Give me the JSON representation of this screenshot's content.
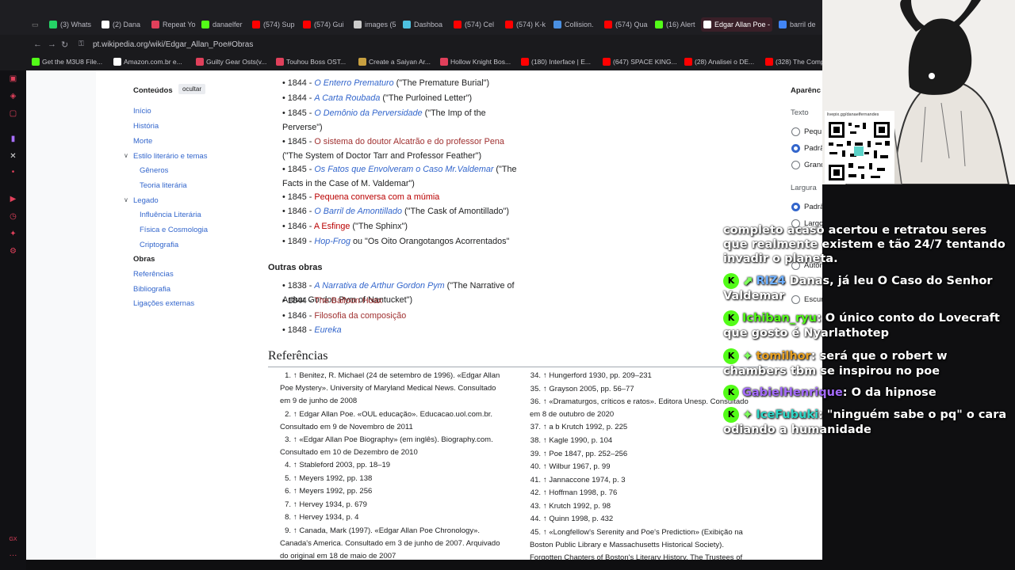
{
  "browser": {
    "tabs": [
      {
        "label": "(3) Whats",
        "color": "#25d366"
      },
      {
        "label": "(2) Dana",
        "color": "#ffffff"
      },
      {
        "label": "Repeat Yo",
        "color": "#e0405b"
      },
      {
        "label": "danaelfer",
        "color": "#53fc18"
      },
      {
        "label": "(574) Sup",
        "color": "#ff0000"
      },
      {
        "label": "(574) Gui",
        "color": "#ff0000"
      },
      {
        "label": "images (5",
        "color": "#cccccc"
      },
      {
        "label": "Dashboa",
        "color": "#4ec1e0"
      },
      {
        "label": "(574) Cel",
        "color": "#ff0000"
      },
      {
        "label": "(574) K-k",
        "color": "#ff0000"
      },
      {
        "label": "Collision.",
        "color": "#4a90e2"
      },
      {
        "label": "(574) Qua",
        "color": "#ff0000"
      },
      {
        "label": "(16) Alert",
        "color": "#53fc18"
      },
      {
        "label": "Edgar Allan Poe -",
        "color": "#ffffff"
      },
      {
        "label": "barril de",
        "color": "#4285f4"
      }
    ],
    "url": "pt.wikipedia.org/wiki/Edgar_Allan_Poe#Obras",
    "bookmarks": [
      {
        "label": "Get the M3U8 File...",
        "color": "#53fc18"
      },
      {
        "label": "Amazon.com.br e...",
        "color": "#ffffff"
      },
      {
        "label": "Guilty Gear Osts(v...",
        "color": "#e0405b"
      },
      {
        "label": "Touhou Boss OST...",
        "color": "#e0405b"
      },
      {
        "label": "Create a Saiyan Ar...",
        "color": "#c8a040"
      },
      {
        "label": "Hollow Knight Bos...",
        "color": "#e0405b"
      },
      {
        "label": "(180) Interface | E...",
        "color": "#ff0000"
      },
      {
        "label": "(647) SPACE KING...",
        "color": "#ff0000"
      },
      {
        "label": "(28) Analisei o DE...",
        "color": "#ff0000"
      },
      {
        "label": "(328) The Comp",
        "color": "#ff0000"
      }
    ]
  },
  "toc": {
    "title": "Conteúdos",
    "hide": "ocultar",
    "items": [
      "Início",
      "História",
      "Morte",
      "Estilo literário e temas",
      "Gêneros",
      "Teoria literária",
      "Legado",
      "Influência Literária",
      "Física e Cosmologia",
      "Criptografia",
      "Obras",
      "Referências",
      "Bibliografia",
      "Ligações externas"
    ]
  },
  "content": {
    "works": [
      {
        "year": "1844 - ",
        "link": "O Enterro Prematuro",
        "rest": " (\"The Premature Burial\")"
      },
      {
        "year": "1844 - ",
        "link": "A Carta Roubada",
        "rest": " (\"The Purloined Letter\")"
      },
      {
        "year": "1845 - ",
        "link": "O Demônio da Perversidade",
        "rest": " (\"The Imp of the Perverse\")"
      },
      {
        "year": "1845 - ",
        "link": "O sistema do doutor Alcatrão e do professor Pena",
        "rest": " (\"The System of Doctor Tarr and Professor Feather\")"
      },
      {
        "year": "1845 - ",
        "link": "Os Fatos que Envolveram o Caso Mr.Valdemar",
        "rest": " (\"The Facts in the Case of M. Valdemar\")"
      },
      {
        "year": "1845 - ",
        "link": "Pequena conversa com a múmia",
        "rest": ""
      },
      {
        "year": "1846 - ",
        "link": "O Barril de Amontillado",
        "rest": " (\"The Cask of Amontillado\")"
      },
      {
        "year": "1846 - ",
        "link": "A Esfinge",
        "rest": " (\"The Sphinx\")"
      },
      {
        "year": "1849 - ",
        "link": "Hop-Frog",
        "rest": " ou \"Os Oito Orangotangos Acorrentados\""
      }
    ],
    "other_title": "Outras obras",
    "other": [
      {
        "year": "1838 - ",
        "link": "A Narrativa de Arthur Gordon Pym",
        "rest": " (\"The Narrative of Arthur Gordon Pym of Nantucket\")"
      },
      {
        "year": "1844 - ",
        "link": "The Balloon Hoax",
        "rest": ""
      },
      {
        "year": "1846 - ",
        "link": "Filosofia da composição",
        "rest": ""
      },
      {
        "year": "1848 - ",
        "link": "Eureka",
        "rest": ""
      }
    ],
    "refs_title": "Referências",
    "refs_left": [
      {
        "n": "1.",
        "text": "↑ Benitez, R. Michael (24 de setembro de 1996). «Edgar Allan Poe Mystery». University of Maryland Medical News. Consultado em 9 de junho de 2008"
      },
      {
        "n": "2.",
        "text": "↑ Edgar Allan Poe. «OUL educação». Educacao.uol.com.br. Consultado em 9 de Novembro de 2011"
      },
      {
        "n": "3.",
        "text": "↑ «Edgar Allan Poe Biography» (em inglês). Biography.com. Consultado em 10 de Dezembro de 2010"
      },
      {
        "n": "4.",
        "text": "↑ Stableford 2003, pp. 18–19"
      },
      {
        "n": "5.",
        "text": "↑ Meyers 1992, pp. 138"
      },
      {
        "n": "6.",
        "text": "↑ Meyers 1992, pp. 256"
      },
      {
        "n": "7.",
        "text": "↑ Hervey 1934, p. 679"
      },
      {
        "n": "8.",
        "text": "↑ Hervey 1934, p. 4"
      },
      {
        "n": "9.",
        "text": "↑ Canada, Mark (1997). «Edgar Allan Poe Chronology». Canada's America. Consultado em 3 de junho de 2007. Arquivado do original em 18 de maio de 2007"
      }
    ],
    "refs_right": [
      {
        "n": "34.",
        "text": "↑ Hungerford 1930, pp. 209–231"
      },
      {
        "n": "35.",
        "text": "↑ Grayson 2005, pp. 56–77"
      },
      {
        "n": "36.",
        "text": "↑ «Dramaturgos, críticos e ratos». Editora Unesp. Consultado em 8 de outubro de 2020"
      },
      {
        "n": "37.",
        "text": "↑ a b Krutch 1992, p. 225"
      },
      {
        "n": "38.",
        "text": "↑ Kagle 1990, p. 104"
      },
      {
        "n": "39.",
        "text": "↑ Poe 1847, pp. 252–256"
      },
      {
        "n": "40.",
        "text": "↑ Wilbur 1967, p. 99"
      },
      {
        "n": "41.",
        "text": "↑ Jannaccone 1974, p. 3"
      },
      {
        "n": "42.",
        "text": "↑ Hoffman 1998, p. 76"
      },
      {
        "n": "43.",
        "text": "↑ Krutch 1992, p. 98"
      },
      {
        "n": "44.",
        "text": "↑ Quinn 1998, p. 432"
      },
      {
        "n": "45.",
        "text": "↑ «Longfellow's Serenity and Poe's Prediction» (Exibição na Boston Public Library e Massachusetts Historical Society). Forgotten Chapters of Boston's Literary History. The Trustees of Boston"
      }
    ]
  },
  "appearance": {
    "title": "Aparênc",
    "text_label": "Texto",
    "text_opts": [
      "Pequ",
      "Padrã",
      "Grand"
    ],
    "width_label": "Largura",
    "width_opts": [
      "Padrão",
      "Largo"
    ],
    "color_opts": [
      "Automático",
      "Escuro"
    ]
  },
  "stream": {
    "qr_caption": "livepix.gg/danaelfernandes"
  },
  "chat": [
    {
      "user": "",
      "text": "completo acaso acertou e retratou seres que realmente existem e tão 24/7 tentando invadir o planeta.",
      "color": "#ffffff"
    },
    {
      "user": "RIZ4",
      "text": " Danas, já leu O Caso do Senhor Valdemar",
      "color": "#6fb0ff"
    },
    {
      "user": "Ichiban_ryu",
      "text": ": O único conto do Lovecraft que gosto é Nyarlathotep",
      "color": "#53fc18"
    },
    {
      "user": "tomilhor",
      "text": ": será que o robert w chambers tbm se inspirou no poe",
      "color": "#e8a020"
    },
    {
      "user": "GabielHenrique",
      "text": ": O da hipnose",
      "color": "#a56bff"
    },
    {
      "user": "IceFubuki",
      "text": ": \"ninguém sabe o pq\" o cara odiando a humanidade",
      "color": "#2fd8c8"
    }
  ]
}
